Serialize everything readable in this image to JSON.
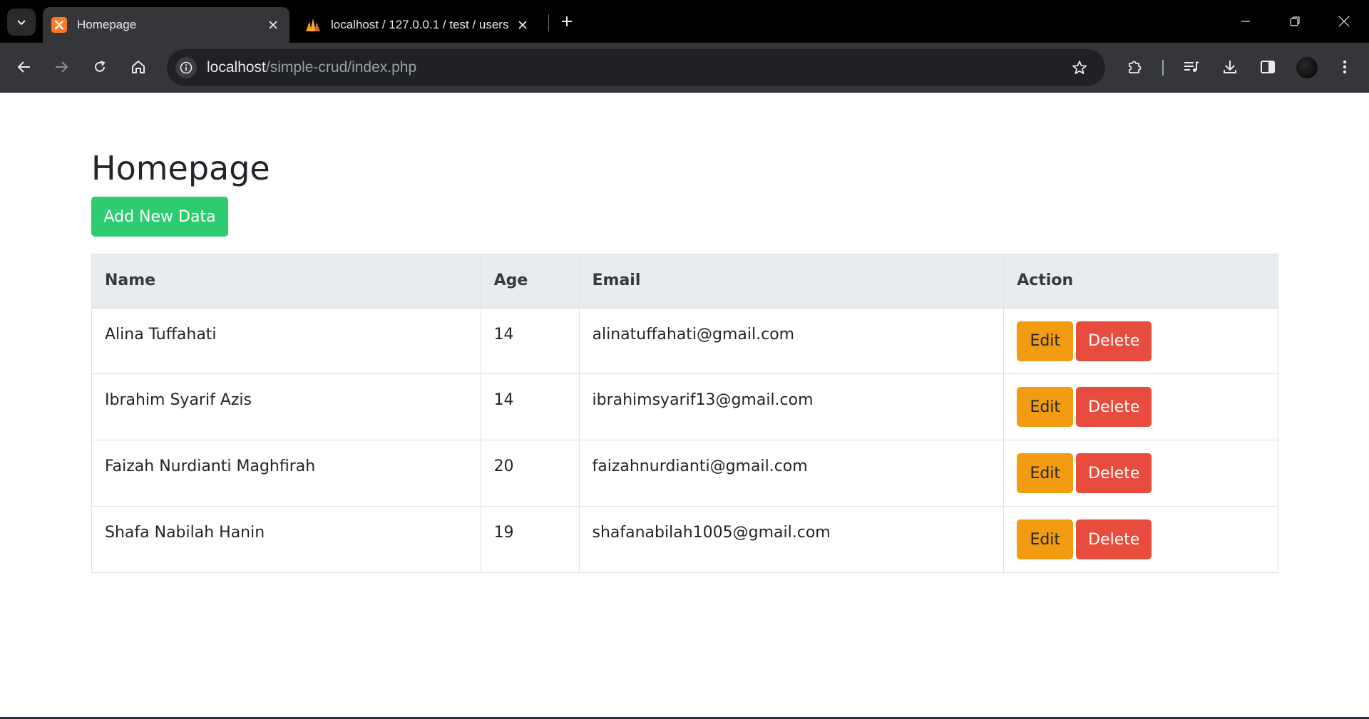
{
  "browser": {
    "tabs": [
      {
        "title": "Homepage",
        "favicon": "xampp-icon",
        "active": true
      },
      {
        "title": "localhost / 127.0.0.1 / test / users",
        "favicon": "phpmyadmin-icon",
        "active": false
      }
    ],
    "url_host": "localhost",
    "url_path": "/simple-crud/index.php"
  },
  "page": {
    "title": "Homepage",
    "add_button": "Add New Data",
    "table": {
      "headers": [
        "Name",
        "Age",
        "Email",
        "Action"
      ],
      "rows": [
        {
          "name": "Alina Tuffahati",
          "age": "14",
          "email": "alinatuffahati@gmail.com"
        },
        {
          "name": "Ibrahim Syarif Azis",
          "age": "14",
          "email": "ibrahimsyarif13@gmail.com"
        },
        {
          "name": "Faizah Nurdianti Maghfirah",
          "age": "20",
          "email": "faizahnurdianti@gmail.com"
        },
        {
          "name": "Shafa Nabilah Hanin",
          "age": "19",
          "email": "shafanabilah1005@gmail.com"
        }
      ],
      "edit_label": "Edit",
      "delete_label": "Delete"
    }
  },
  "colors": {
    "add_button": "#2ecc71",
    "edit_button": "#f39c12",
    "delete_button": "#e74c3c",
    "table_header_bg": "#e9ecef"
  }
}
